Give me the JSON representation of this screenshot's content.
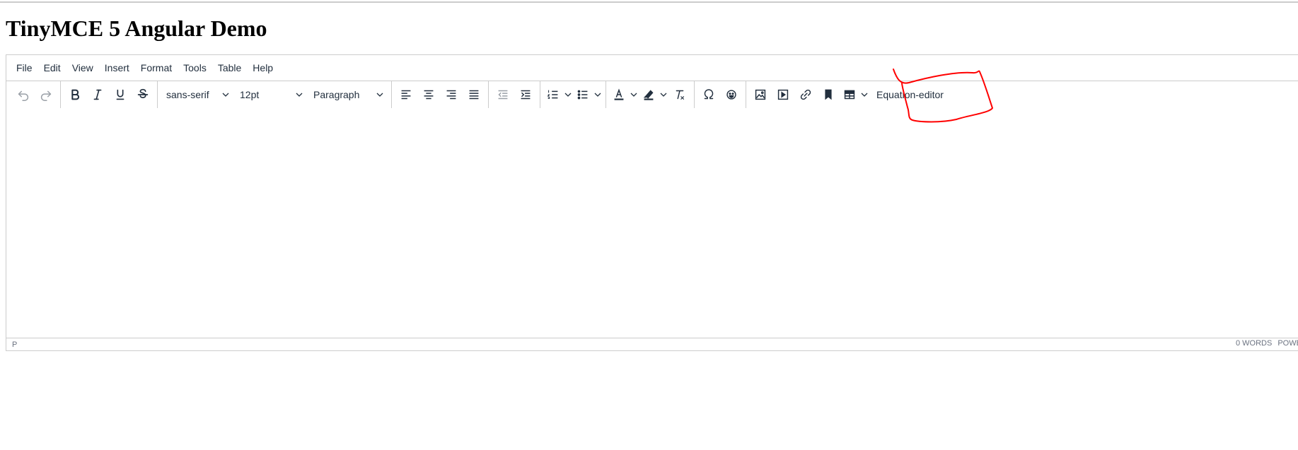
{
  "page": {
    "title": "TinyMCE 5 Angular Demo"
  },
  "menubar": {
    "items": [
      "File",
      "Edit",
      "View",
      "Insert",
      "Format",
      "Tools",
      "Table",
      "Help"
    ]
  },
  "toolbar": {
    "font_family": "sans-serif",
    "font_size": "12pt",
    "block_format": "Paragraph",
    "equation_editor_label": "Equation-editor",
    "icons": {
      "undo": "undo-icon",
      "redo": "redo-icon",
      "bold": "bold-icon",
      "italic": "italic-icon",
      "underline": "underline-icon",
      "strikethrough": "strikethrough-icon",
      "align_left": "align-left-icon",
      "align_center": "align-center-icon",
      "align_right": "align-right-icon",
      "align_justify": "align-justify-icon",
      "outdent": "outdent-icon",
      "indent": "indent-icon",
      "numbered_list": "numbered-list-icon",
      "bullet_list": "bullet-list-icon",
      "text_color": "text-color-icon",
      "highlight": "highlight-icon",
      "clear_formatting": "clear-formatting-icon",
      "special_char": "omega-icon",
      "emoticons": "smiley-icon",
      "image": "image-icon",
      "media": "media-icon",
      "link": "link-icon",
      "bookmark": "bookmark-icon",
      "table": "table-icon"
    }
  },
  "statusbar": {
    "path": "P",
    "word_count": "0 WORDS",
    "powered": "POWE"
  },
  "colors": {
    "border": "#cccccc",
    "text": "#222f3e",
    "annotation": "#ff0000"
  }
}
